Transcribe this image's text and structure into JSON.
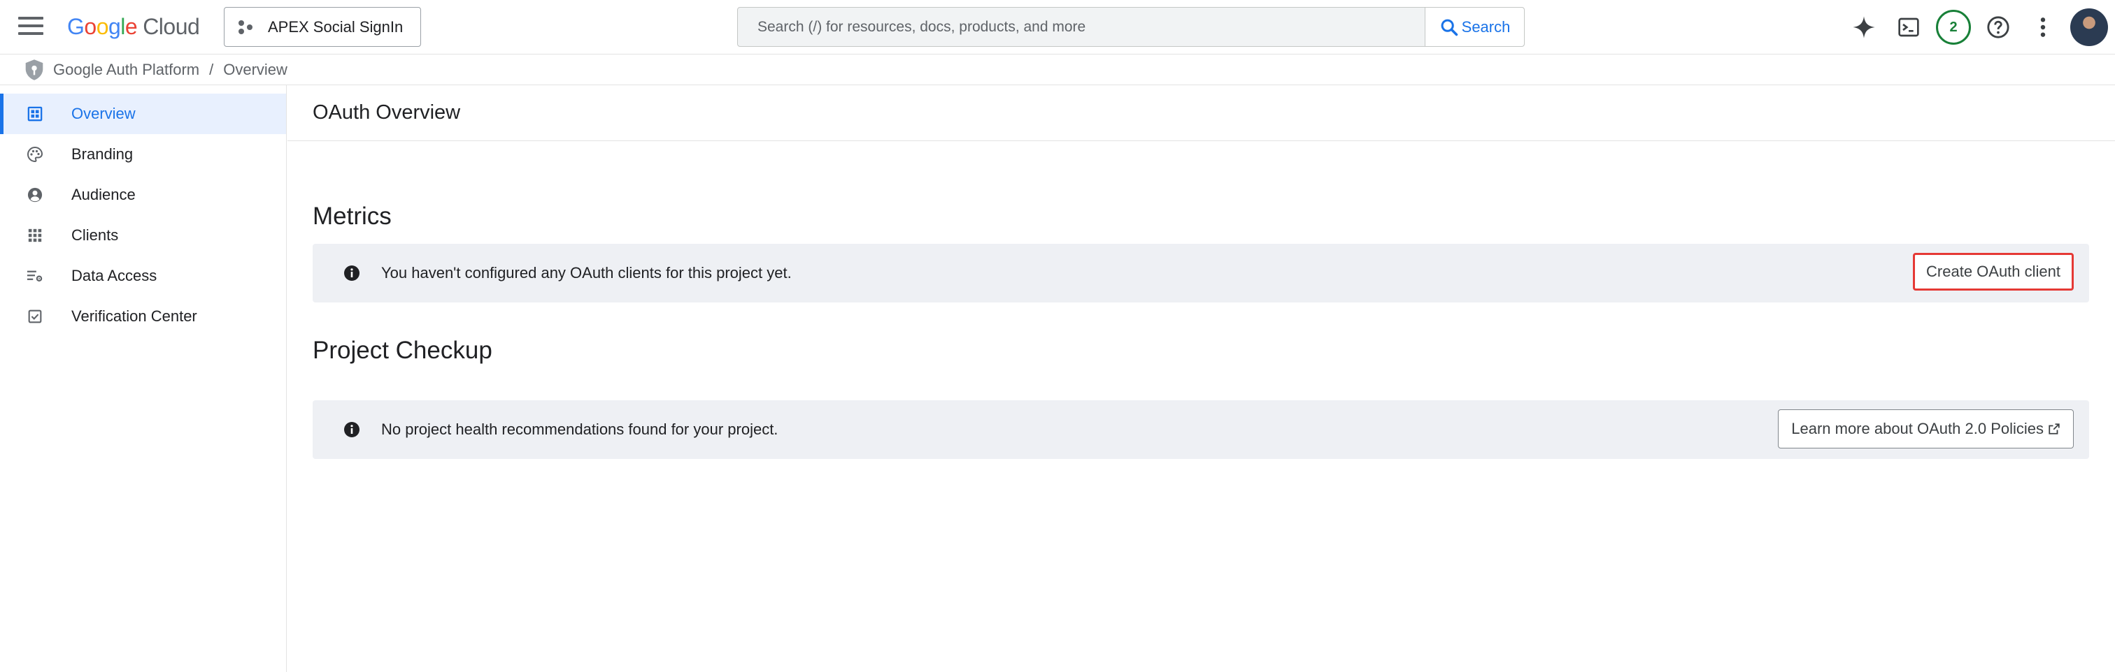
{
  "header": {
    "logo_google": [
      "G",
      "o",
      "o",
      "g",
      "l",
      "e"
    ],
    "logo_cloud": "Cloud",
    "project_name": "APEX Social SignIn",
    "search_placeholder": "Search (/) for resources, docs, products, and more",
    "search_button": "Search",
    "notification_count": "2"
  },
  "breadcrumb": {
    "platform": "Google Auth Platform",
    "separator": "/",
    "current": "Overview"
  },
  "sidebar": {
    "items": [
      {
        "label": "Overview",
        "icon": "dashboard-icon",
        "active": true
      },
      {
        "label": "Branding",
        "icon": "palette-icon",
        "active": false
      },
      {
        "label": "Audience",
        "icon": "account-circle-icon",
        "active": false
      },
      {
        "label": "Clients",
        "icon": "apps-grid-icon",
        "active": false
      },
      {
        "label": "Data Access",
        "icon": "list-settings-icon",
        "active": false
      },
      {
        "label": "Verification Center",
        "icon": "checkbox-icon",
        "active": false
      }
    ]
  },
  "main": {
    "page_title": "OAuth Overview",
    "metrics": {
      "title": "Metrics",
      "message": "You haven't configured any OAuth clients for this project yet.",
      "button": "Create OAuth client"
    },
    "checkup": {
      "title": "Project Checkup",
      "message": "No project health recommendations found for your project.",
      "button": "Learn more about OAuth 2.0 Policies"
    }
  },
  "colors": {
    "accent": "#1a73e8",
    "banner_bg": "#eef0f4",
    "highlight": "#e53935",
    "badge_green": "#188038"
  }
}
